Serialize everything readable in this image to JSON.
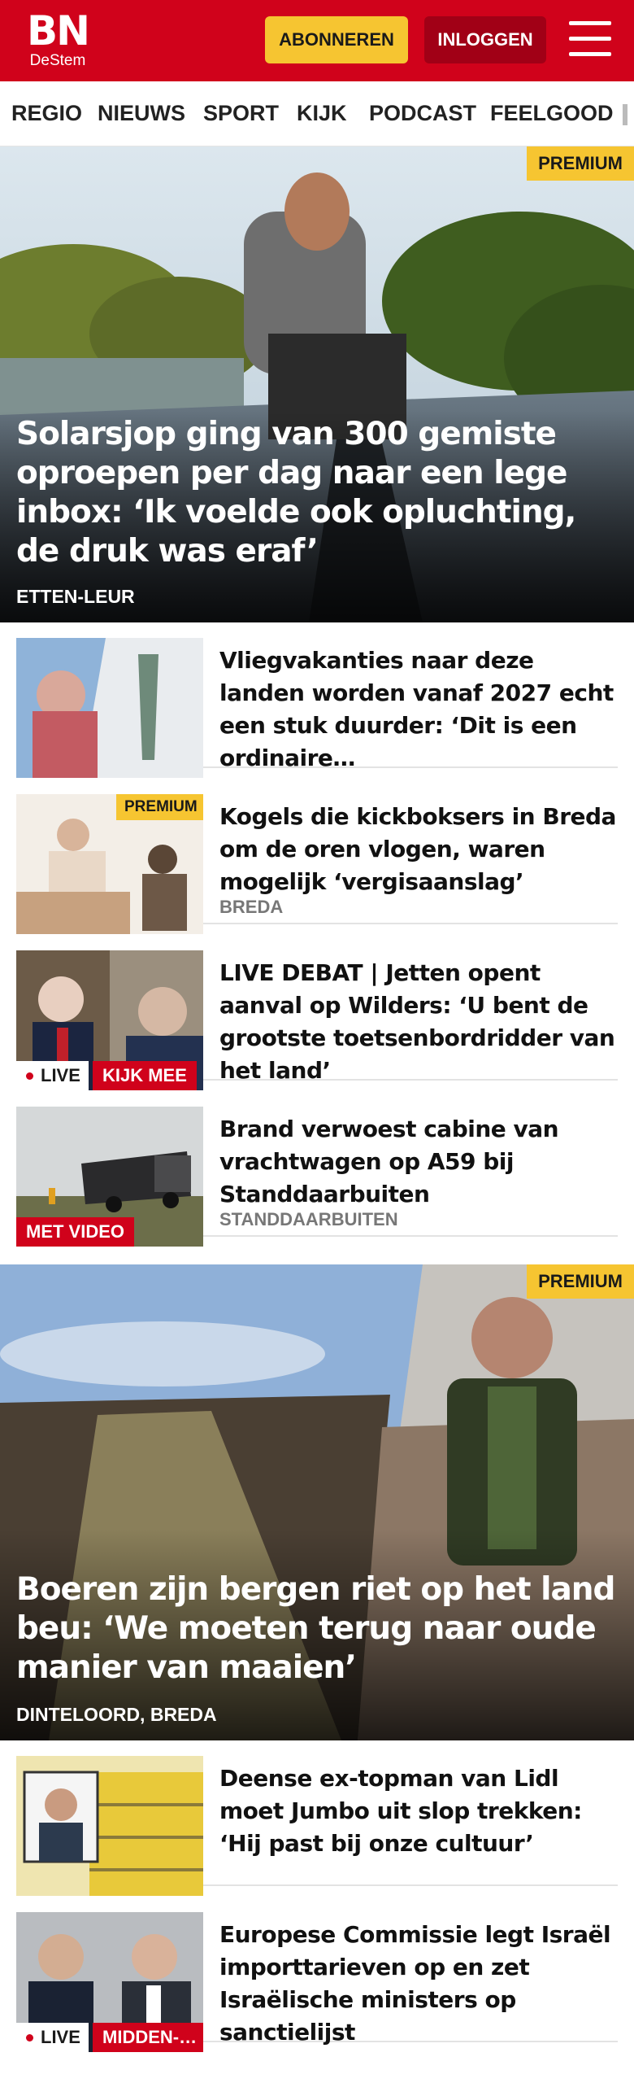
{
  "header": {
    "logo_mark": "BN",
    "logo_sub": "DeStem",
    "subscribe_label": "ABONNEREN",
    "login_label": "INLOGGEN",
    "brand_red": "#d0021b",
    "accent_yellow": "#f6c531"
  },
  "nav": {
    "items": [
      "REGIO",
      "NIEUWS",
      "SPORT",
      "KIJK",
      "PODCAST",
      "FEELGOOD"
    ]
  },
  "hero1": {
    "badge": "PREMIUM",
    "title": "Solarsjop ging van 300 gemiste oproepen per dag naar een lege inbox: ‘Ik voelde ook opluchting, de druk was eraf’",
    "location": "ETTEN-LEUR"
  },
  "articles": [
    {
      "title": "Vliegvakanties naar deze landen worden vanaf 2027 echt een stuk duurder: ‘Dit is een ordinaire…"
    },
    {
      "title": "Kogels die kickboksers in Breda om de oren vlogen, waren mogelijk ‘vergisaanslag’",
      "location": "BREDA",
      "badge": "PREMIUM"
    },
    {
      "title": "LIVE DEBAT | Jetten opent aanval op Wilders: ‘U bent de grootste toetsenbordridder van het land’",
      "live": "LIVE",
      "tag": "KIJK MEE"
    },
    {
      "title": "Brand verwoest cabine van vrachtwagen op A59 bij Standdaarbuiten",
      "location": "STANDDAARBUITEN",
      "tag": "MET VIDEO"
    }
  ],
  "hero2": {
    "badge": "PREMIUM",
    "title": "Boeren zijn bergen riet op het land beu: ‘We moeten terug naar oude manier van maaien’",
    "location": "DINTELOORD, BREDA"
  },
  "articles2": [
    {
      "title": "Deense ex-topman van Lidl moet Jumbo uit slop trekken: ‘Hij past bij onze cultuur’"
    },
    {
      "title": "Europese Commissie legt Israël importtarieven op en zet Israëlische ministers op sanctielijst",
      "live": "LIVE",
      "tag": "MIDDEN-…"
    }
  ],
  "icons": [
    "hamburger-menu-icon",
    "live-dot-icon"
  ]
}
